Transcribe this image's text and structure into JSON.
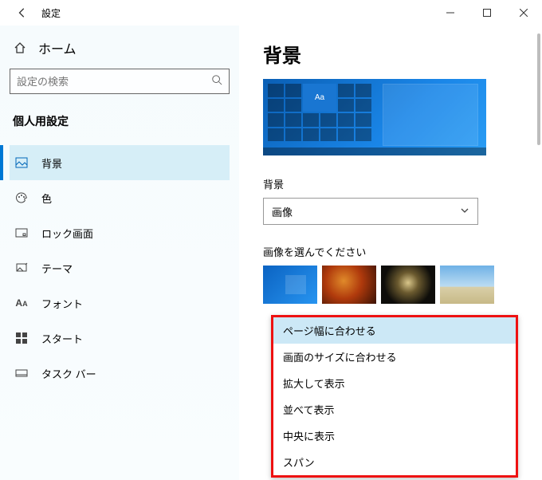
{
  "titlebar": {
    "title": "設定"
  },
  "sidebar": {
    "home": "ホーム",
    "searchPlaceholder": "設定の検索",
    "section": "個人用設定",
    "items": [
      {
        "label": "背景"
      },
      {
        "label": "色"
      },
      {
        "label": "ロック画面"
      },
      {
        "label": "テーマ"
      },
      {
        "label": "フォント"
      },
      {
        "label": "スタート"
      },
      {
        "label": "タスク バー"
      }
    ]
  },
  "main": {
    "title": "背景",
    "previewSample": "Aa",
    "bgLabel": "背景",
    "bgValue": "画像",
    "chooseLabel": "画像を選んでください",
    "fitOptions": [
      "ページ幅に合わせる",
      "画面のサイズに合わせる",
      "拡大して表示",
      "並べて表示",
      "中央に表示",
      "スパン"
    ]
  }
}
